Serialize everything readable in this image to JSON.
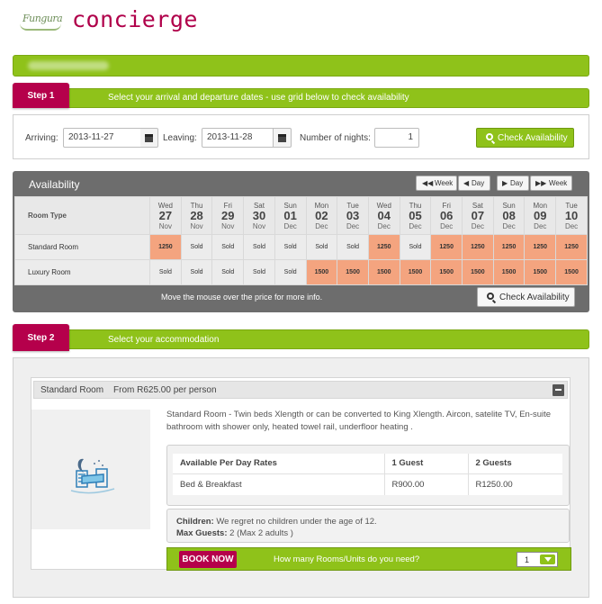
{
  "brand": {
    "logo_text": "Fungura",
    "name": "concierge"
  },
  "step1": {
    "tab_label": "Step 1",
    "instruction": "Select your arrival and departure dates - use grid below to check availability",
    "arriving_label": "Arriving:",
    "arriving_value": "2013-11-27",
    "leaving_label": "Leaving:",
    "leaving_value": "2013-11-28",
    "nights_label": "Number of nights:",
    "nights_value": "1",
    "check_button": "Check Availability"
  },
  "availability": {
    "title": "Availability",
    "nav": {
      "prev_week": "Week",
      "prev_day": "Day",
      "next_day": "Day",
      "next_week": "Week"
    },
    "room_type_header": "Room Type",
    "days": [
      {
        "dow": "Wed",
        "date": "27",
        "month": "Nov"
      },
      {
        "dow": "Thu",
        "date": "28",
        "month": "Nov"
      },
      {
        "dow": "Fri",
        "date": "29",
        "month": "Nov"
      },
      {
        "dow": "Sat",
        "date": "30",
        "month": "Nov"
      },
      {
        "dow": "Sun",
        "date": "01",
        "month": "Dec"
      },
      {
        "dow": "Mon",
        "date": "02",
        "month": "Dec"
      },
      {
        "dow": "Tue",
        "date": "03",
        "month": "Dec"
      },
      {
        "dow": "Wed",
        "date": "04",
        "month": "Dec"
      },
      {
        "dow": "Thu",
        "date": "05",
        "month": "Dec"
      },
      {
        "dow": "Fri",
        "date": "06",
        "month": "Dec"
      },
      {
        "dow": "Sat",
        "date": "07",
        "month": "Dec"
      },
      {
        "dow": "Sun",
        "date": "08",
        "month": "Dec"
      },
      {
        "dow": "Mon",
        "date": "09",
        "month": "Dec"
      },
      {
        "dow": "Tue",
        "date": "10",
        "month": "Dec"
      }
    ],
    "rooms": [
      {
        "name": "Standard Room",
        "cells": [
          "1250",
          "Sold",
          "Sold",
          "Sold",
          "Sold",
          "Sold",
          "Sold",
          "1250",
          "Sold",
          "1250",
          "1250",
          "1250",
          "1250",
          "1250"
        ]
      },
      {
        "name": "Luxury Room",
        "cells": [
          "Sold",
          "Sold",
          "Sold",
          "Sold",
          "Sold",
          "1500",
          "1500",
          "1500",
          "1500",
          "1500",
          "1500",
          "1500",
          "1500",
          "1500"
        ]
      }
    ],
    "footer_hint": "Move the mouse over the price for more info.",
    "check_button": "Check Availability",
    "price_color": "#f4a47f"
  },
  "step2": {
    "tab_label": "Step 2",
    "instruction": "Select your accommodation",
    "room": {
      "name": "Standard Room",
      "from_price": "From R625.00 per person",
      "description": "Standard Room - Twin beds Xlength or can be converted to King Xlength. Aircon, satelite TV, En-suite bathroom with shower only, heated towel rail, underfloor heating .",
      "rates": {
        "headers": [
          "Available Per Day Rates",
          "1 Guest",
          "2 Guests"
        ],
        "rows": [
          [
            "Bed & Breakfast",
            "R900.00",
            "R1250.00"
          ]
        ]
      },
      "children_label": "Children:",
      "children_text": "We regret no children under the age of 12.",
      "max_guests_label": "Max Guests:",
      "max_guests_text": "2  (Max  2 adults )",
      "book_button": "BOOK NOW",
      "rooms_question": "How many Rooms/Units do you need?",
      "rooms_value": "1"
    }
  },
  "colors": {
    "green": "#8fc21a",
    "magenta": "#b5004b",
    "brand": "#b0004a"
  }
}
